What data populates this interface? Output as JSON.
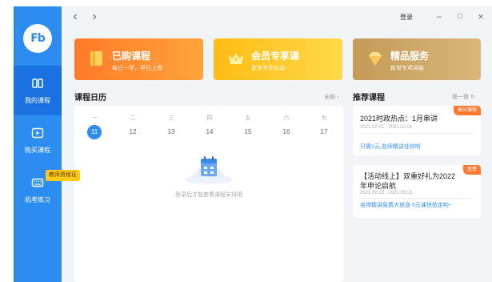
{
  "sidebar": {
    "logo_text": "Fb",
    "items": [
      {
        "label": "我的课程",
        "icon": "book-icon",
        "active": true
      },
      {
        "label": "购买课程",
        "icon": "video-play-icon",
        "active": false
      },
      {
        "label": "机考练习",
        "icon": "keyboard-icon",
        "active": false
      }
    ],
    "tooltip": "教师资格证"
  },
  "titlebar": {
    "back": "‹",
    "forward": "›",
    "login_label": "登录",
    "minimize": "–",
    "maximize": "□",
    "close": "✕"
  },
  "feature_cards": [
    {
      "title": "已购课程",
      "subtitle": "每日一学，早日上岸",
      "icon": "book-icon",
      "color": "#ff8a2a"
    },
    {
      "title": "会员专享课",
      "subtitle": "更多专享权益",
      "icon": "crown-icon",
      "color": "#ffc21a"
    },
    {
      "title": "精品服务",
      "subtitle": "新增专项突破",
      "icon": "diamond-icon",
      "color": "#c9a262"
    }
  ],
  "calendar": {
    "title": "课程日历",
    "all_link": "全部 ›",
    "weekdays": [
      "一",
      "二",
      "三",
      "四",
      "五",
      "六",
      "七"
    ],
    "days": [
      "11",
      "12",
      "13",
      "14",
      "15",
      "16",
      "17"
    ],
    "today_index": 0,
    "empty_text": "登录后才能查看课程安排哦"
  },
  "recommended": {
    "title": "推荐课程",
    "refresh_link": "换一换 ↻",
    "items": [
      {
        "badge": "高分课程",
        "title": "2021时政热点：1月串讲",
        "date": "2021.02.01 - 2021.02.01",
        "desc": "只需1元,名师精讲任你听"
      },
      {
        "badge": "免费",
        "title": "【活动线上】双重好礼为2022年申论启航",
        "date": "2021.09.23 - 2021.09.23",
        "desc": "名师精讲免费大放送 0元课快抢走哟~"
      }
    ]
  },
  "colors": {
    "primary": "#2d8cf0",
    "badge": "#ff7a2f",
    "tooltip": "#ffc91a"
  }
}
